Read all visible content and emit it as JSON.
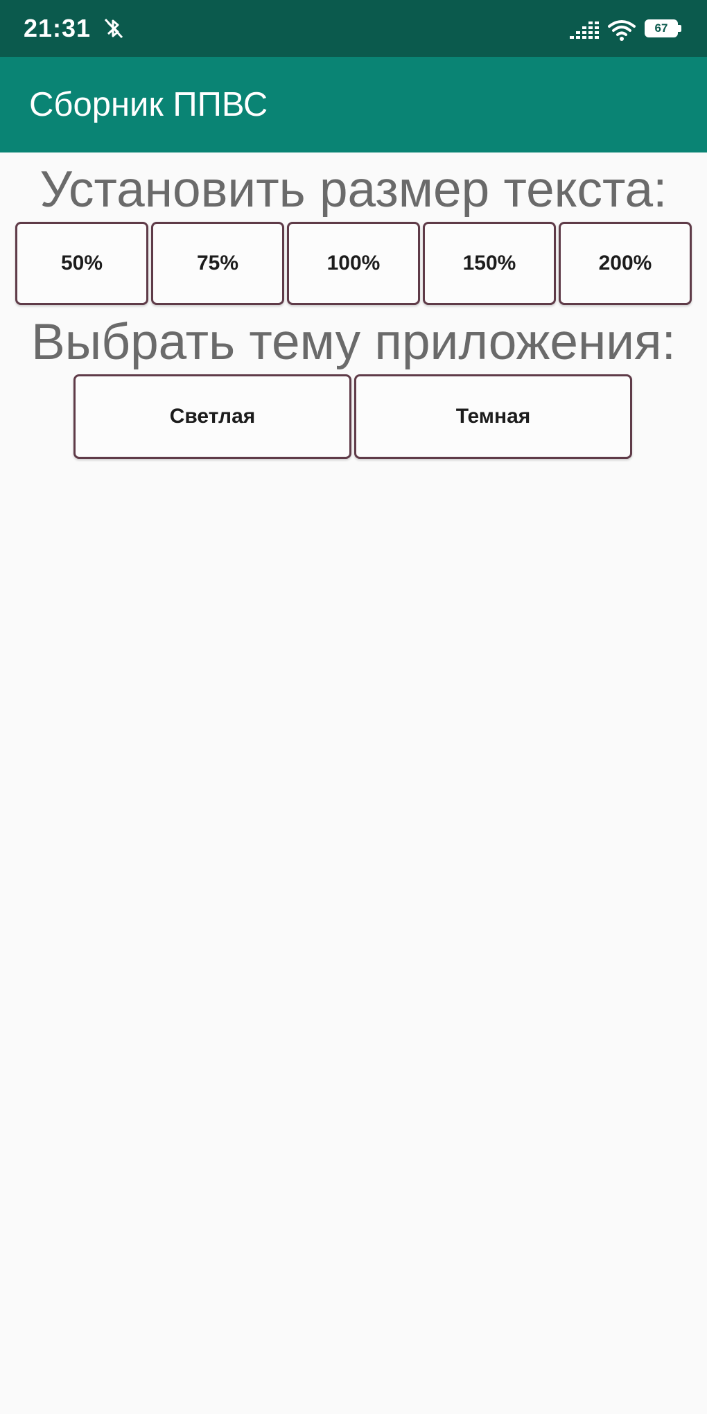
{
  "status_bar": {
    "time": "21:31",
    "notification_icon": "bluetooth-off-icon",
    "signal_icon": "cellular-signal-icon",
    "wifi_icon": "wifi-icon",
    "battery_icon": "battery-icon",
    "battery_level": "67",
    "background_color": "#0b5a4d"
  },
  "app_bar": {
    "title": "Сборник ППВС",
    "background_color": "#0a8474"
  },
  "text_size": {
    "heading": "Установить размер текста:",
    "options": [
      "50%",
      "75%",
      "100%",
      "150%",
      "200%"
    ]
  },
  "theme": {
    "heading": "Выбрать тему приложения:",
    "options": [
      "Светлая",
      "Темная"
    ]
  },
  "colors": {
    "heading_text": "#6a6a6a",
    "button_border": "#5f3b48",
    "page_background": "#fafafa"
  }
}
